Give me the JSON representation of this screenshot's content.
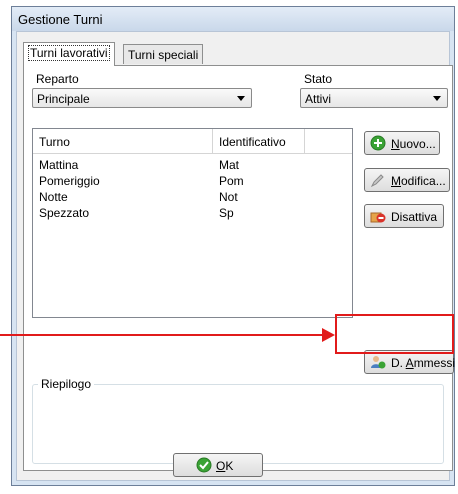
{
  "window": {
    "title": "Gestione Turni"
  },
  "tabs": [
    {
      "label": "Turni lavorativi",
      "active": true
    },
    {
      "label": "Turni speciali",
      "active": false
    }
  ],
  "filters": {
    "reparto_label": "Reparto",
    "reparto_value": "Principale",
    "stato_label": "Stato",
    "stato_value": "Attivi"
  },
  "table": {
    "columns": [
      "Turno",
      "Identificativo"
    ],
    "rows": [
      [
        "Mattina",
        "Mat"
      ],
      [
        "Pomeriggio",
        "Pom"
      ],
      [
        "Notte",
        "Not"
      ],
      [
        "Spezzato",
        "Sp"
      ]
    ]
  },
  "buttons": {
    "nuovo_pre": "",
    "nuovo_key": "N",
    "nuovo_post": "uovo...",
    "modifica_pre": "",
    "modifica_key": "M",
    "modifica_post": "odifica...",
    "disattiva": "Disattiva",
    "ammessi_pre": "D. ",
    "ammessi_key": "A",
    "ammessi_post": "mmessi",
    "ok_pre": "",
    "ok_key": "O",
    "ok_post": "K"
  },
  "summary": {
    "label": "Riepilogo"
  },
  "colors": {
    "annotation": "#e11b1b",
    "add_icon": "#3aa335",
    "ok_icon": "#3aa335"
  },
  "icons": [
    "add-icon",
    "edit-icon",
    "deactivate-icon",
    "users-icon",
    "check-icon"
  ]
}
